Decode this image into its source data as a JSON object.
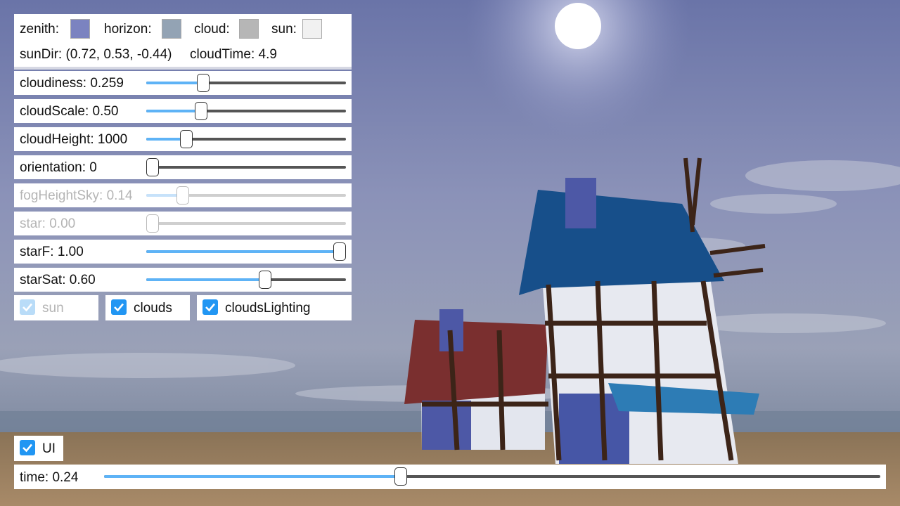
{
  "colors": {
    "zenith": "#7b83c0",
    "horizon": "#93a3b4",
    "cloud": "#b6b6b6",
    "sun": "#f1f1f1",
    "slider_fill": "#5eb3f6",
    "checkbox": "#2196f3"
  },
  "info": {
    "zenith_label": "zenith:",
    "horizon_label": "horizon:",
    "cloud_label": "cloud:",
    "sun_label": "sun:",
    "sundir_text": "sunDir: (0.72, 0.53, -0.44)",
    "cloudtime_text": "cloudTime: 4.9"
  },
  "sliders": [
    {
      "name": "cloudiness",
      "text": "cloudiness: 0.259",
      "fraction": 0.27,
      "disabled": false
    },
    {
      "name": "cloudscale",
      "text": "cloudScale: 0.50",
      "fraction": 0.26,
      "disabled": false
    },
    {
      "name": "cloudheight",
      "text": "cloudHeight: 1000",
      "fraction": 0.18,
      "disabled": false
    },
    {
      "name": "orientation",
      "text": "orientation: 0",
      "fraction": 0.0,
      "disabled": false
    },
    {
      "name": "fogheightsky",
      "text": "fogHeightSky: 0.14",
      "fraction": 0.16,
      "disabled": true
    },
    {
      "name": "star",
      "text": "star: 0.00",
      "fraction": 0.0,
      "disabled": true
    },
    {
      "name": "starf",
      "text": "starF: 1.00",
      "fraction": 1.0,
      "disabled": false
    },
    {
      "name": "starsat",
      "text": "starSat: 0.60",
      "fraction": 0.6,
      "disabled": false
    }
  ],
  "checkboxes": {
    "sun": {
      "label": "sun",
      "checked": true,
      "disabled": true
    },
    "clouds": {
      "label": "clouds",
      "checked": true,
      "disabled": false
    },
    "clouds_lighting": {
      "label": "cloudsLighting",
      "checked": true,
      "disabled": false
    },
    "ui": {
      "label": "UI",
      "checked": true,
      "disabled": false
    }
  },
  "time": {
    "text": "time: 0.24",
    "fraction": 0.38
  }
}
